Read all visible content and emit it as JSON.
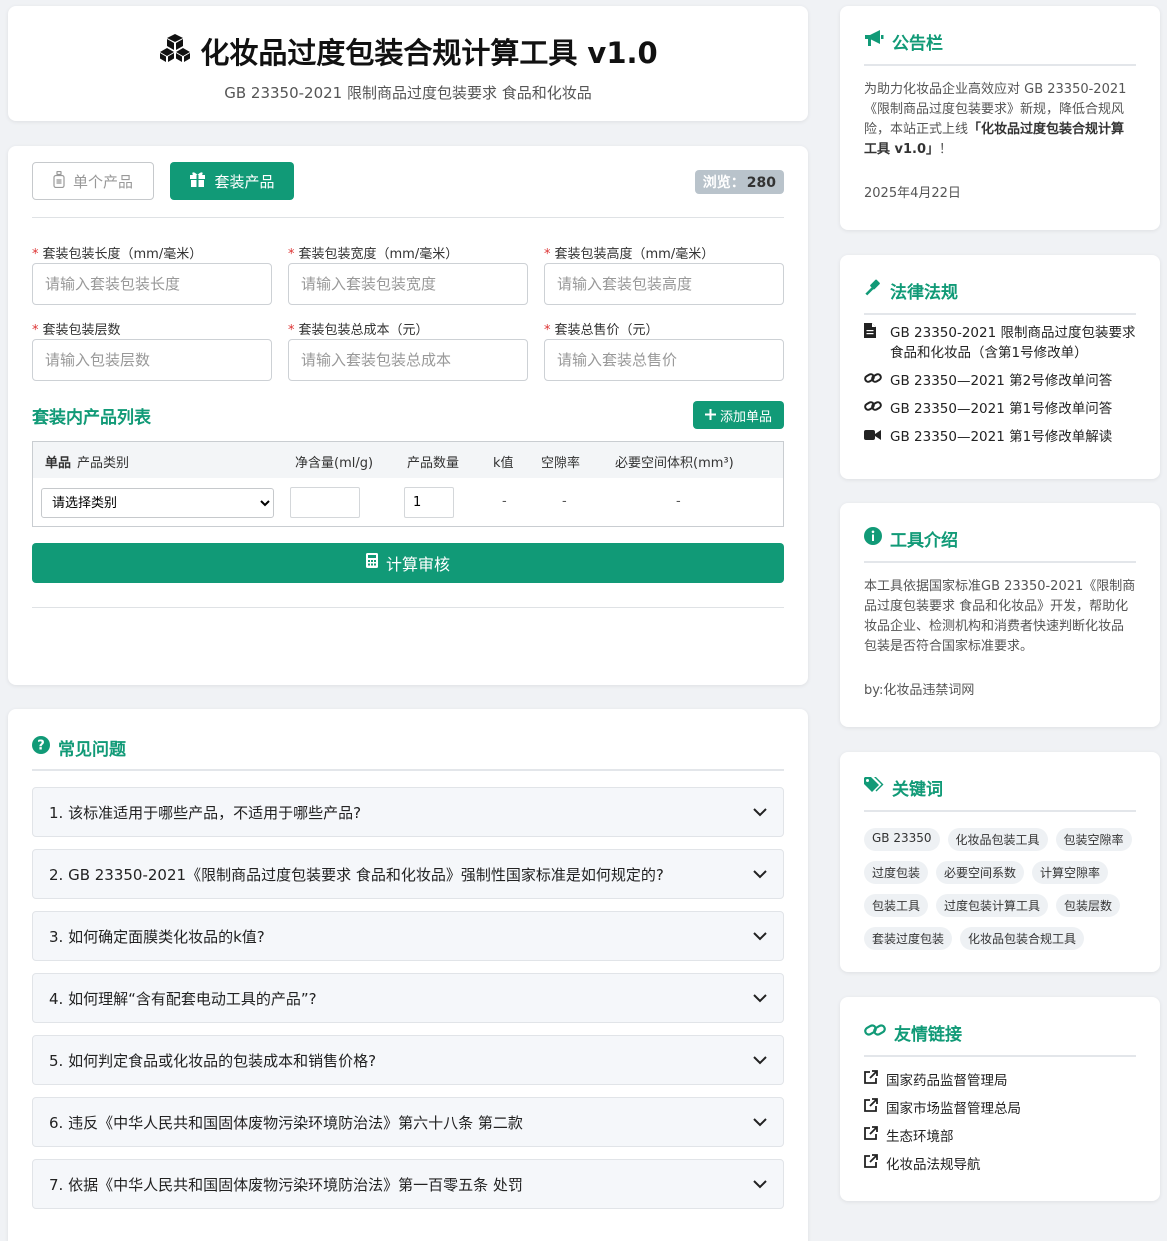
{
  "header": {
    "title": "化妆品过度包装合规计算工具 v1.0",
    "subtitle": "GB 23350-2021 限制商品过度包装要求 食品和化妆品"
  },
  "tabs": {
    "single": "单个产品",
    "bundle": "套装产品"
  },
  "views": {
    "label": "浏览：",
    "count": "280"
  },
  "fields": [
    {
      "label": "套装包装长度（mm/毫米）",
      "placeholder": "请输入套装包装长度"
    },
    {
      "label": "套装包装宽度（mm/毫米）",
      "placeholder": "请输入套装包装宽度"
    },
    {
      "label": "套装包装高度（mm/毫米）",
      "placeholder": "请输入套装包装高度"
    },
    {
      "label": "套装包装层数",
      "placeholder": "请输入包装层数"
    },
    {
      "label": "套装包装总成本（元）",
      "placeholder": "请输入套装包装总成本"
    },
    {
      "label": "套装总售价（元）",
      "placeholder": "请输入套装总售价"
    }
  ],
  "product_list": {
    "title": "套装内产品列表",
    "add_button": "添加单品",
    "columns": [
      "单品",
      "产品类别",
      "净含量(ml/g)",
      "产品数量",
      "k值",
      "空隙率",
      "必要空间体积(mm³)"
    ],
    "row": {
      "category": "请选择类别",
      "net": "",
      "quantity": "1",
      "k": "-",
      "void": "-",
      "volume": "-"
    }
  },
  "calc_button": "计算审核",
  "faq": {
    "title": "常见问题",
    "items": [
      "1. 该标准适用于哪些产品，不适用于哪些产品?",
      "2. GB 23350-2021《限制商品过度包装要求 食品和化妆品》强制性国家标准是如何规定的?",
      "3. 如何确定面膜类化妆品的k值?",
      "4. 如何理解“含有配套电动工具的产品”?",
      "5. 如何判定食品或化妆品的包装成本和销售价格?",
      "6. 违反《中华人民共和国固体废物污染环境防治法》第六十八条 第二款",
      "7. 依据《中华人民共和国固体废物污染环境防治法》第一百零五条 处罚"
    ]
  },
  "notice": {
    "title": "公告栏",
    "text_before": "为助力化妆品企业高效应对 GB 23350-2021《限制商品过度包装要求》新规，降低合规风险，本站正式上线",
    "text_bold": "「化妆品过度包装合规计算工具 v1.0」",
    "text_after": "！",
    "date": "2025年4月22日"
  },
  "laws": {
    "title": "法律法规",
    "items": [
      {
        "icon": "file-icon",
        "text": "GB 23350-2021 限制商品过度包装要求 食品和化妆品（含第1号修改单）"
      },
      {
        "icon": "link-icon",
        "text": "GB 23350—2021 第2号修改单问答"
      },
      {
        "icon": "link-icon",
        "text": "GB 23350—2021 第1号修改单问答"
      },
      {
        "icon": "video-icon",
        "text": "GB 23350—2021 第1号修改单解读"
      }
    ]
  },
  "intro": {
    "title": "工具介绍",
    "text": "本工具依据国家标准GB 23350-2021《限制商品过度包装要求 食品和化妆品》开发，帮助化妆品企业、检测机构和消费者快速判断化妆品包装是否符合国家标准要求。",
    "author": "by:化妆品违禁词网"
  },
  "keywords": {
    "title": "关键词",
    "items": [
      "GB 23350",
      "化妆品包装工具",
      "包装空隙率",
      "过度包装",
      "必要空间系数",
      "计算空隙率",
      "包装工具",
      "过度包装计算工具",
      "包装层数",
      "套装过度包装",
      "化妆品包装合规工具"
    ]
  },
  "links": {
    "title": "友情链接",
    "items": [
      "国家药品监督管理局",
      "国家市场监督管理总局",
      "生态环境部",
      "化妆品法规导航"
    ]
  },
  "colors": {
    "accent": "#119a77",
    "background": "#f0f2f5"
  }
}
